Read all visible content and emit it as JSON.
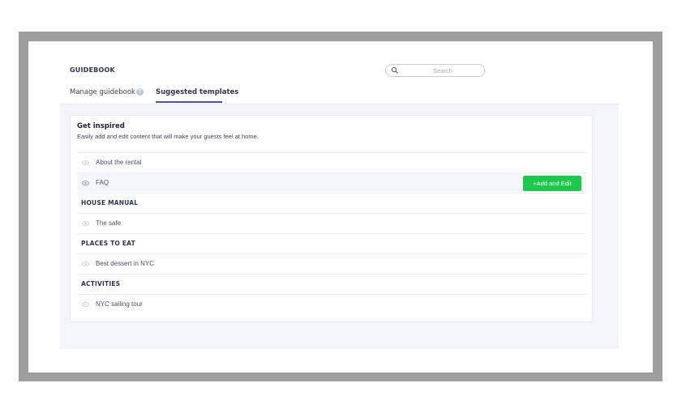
{
  "header": {
    "title": "GUIDEBOOK",
    "search_placeholder": "Search"
  },
  "tabs": [
    {
      "label": "Manage guidebook",
      "active": false
    },
    {
      "label": "Suggested templates",
      "active": true
    }
  ],
  "card": {
    "title": "Get inspired",
    "subtitle": "Easily add and edit content that will make your guests feel at home.",
    "rows": [
      {
        "type": "item",
        "label": "About the rental",
        "icon": "eye-icon"
      },
      {
        "type": "item",
        "label": "FAQ",
        "icon": "eye-icon",
        "highlighted": true,
        "action_label": "+Add and Edit"
      },
      {
        "type": "section",
        "label": "HOUSE MANUAL"
      },
      {
        "type": "item",
        "label": "The safe",
        "icon": "eye-icon"
      },
      {
        "type": "section",
        "label": "PLACES TO EAT"
      },
      {
        "type": "item",
        "label": "Best dessert in NYC",
        "icon": "eye-icon"
      },
      {
        "type": "section",
        "label": "ACTIVITIES"
      },
      {
        "type": "item",
        "label": "NYC sailing tour",
        "icon": "eye-icon"
      }
    ]
  },
  "colors": {
    "accent": "#4a4fa8",
    "action_green": "#1ec84c",
    "frame_gray": "#9e9e9e"
  }
}
